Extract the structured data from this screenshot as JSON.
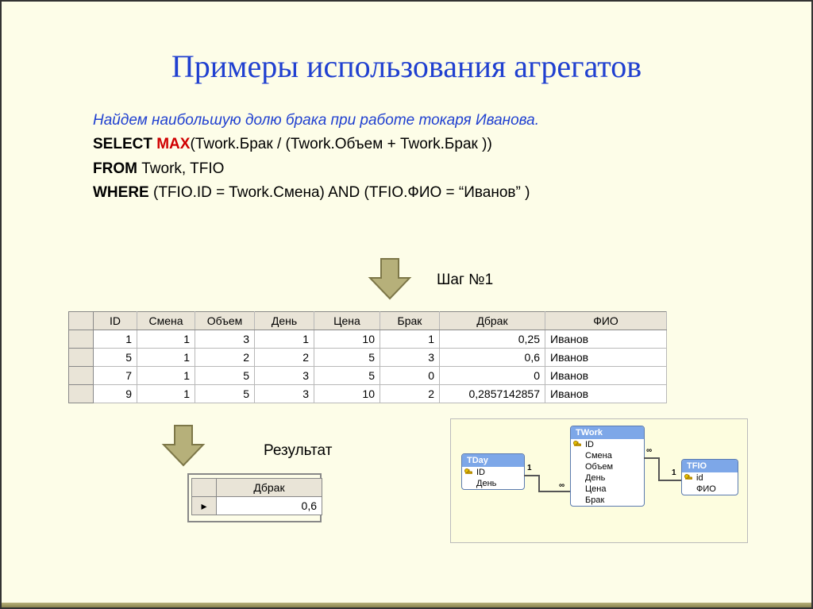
{
  "title": "Примеры использования агрегатов",
  "intro": "Найдем наибольшую долю брака при работе токаря Иванова.",
  "sql": {
    "l1_kw": "SELECT ",
    "l1_fn": "MAX",
    "l1_rest": "(Twork.Брак / (Twork.Объем + Twork.Брак ))",
    "l2_kw": "FROM ",
    "l2_rest": "Twork, TFIO",
    "l3_kw": "WHERE ",
    "l3_rest": "(TFIO.ID = Twork.Смена) AND (TFIO.ФИО = “Иванов” )"
  },
  "step_label": "Шаг №1",
  "result_label": "Результат",
  "table": {
    "headers": [
      "ID",
      "Смена",
      "Объем",
      "День",
      "Цена",
      "Брак",
      "Дбрак",
      "ФИО"
    ],
    "rows": [
      [
        "1",
        "1",
        "3",
        "1",
        "10",
        "1",
        "0,25",
        "Иванов"
      ],
      [
        "5",
        "1",
        "2",
        "2",
        "5",
        "3",
        "0,6",
        "Иванов"
      ],
      [
        "7",
        "1",
        "5",
        "3",
        "5",
        "0",
        "0",
        "Иванов"
      ],
      [
        "9",
        "1",
        "5",
        "3",
        "10",
        "2",
        "0,2857142857",
        "Иванов"
      ]
    ]
  },
  "result": {
    "header": "Дбрак",
    "value": "0,6",
    "marker": "▸"
  },
  "schema": {
    "tday": {
      "title": "TDay",
      "fields": [
        "ID",
        "День"
      ],
      "key": 0
    },
    "twork": {
      "title": "TWork",
      "fields": [
        "ID",
        "Смена",
        "Объем",
        "День",
        "Цена",
        "Брак"
      ],
      "key": 0
    },
    "tfio": {
      "title": "TFIO",
      "fields": [
        "id",
        "ФИО"
      ],
      "key": 0
    },
    "one": "1",
    "many": "∞"
  }
}
